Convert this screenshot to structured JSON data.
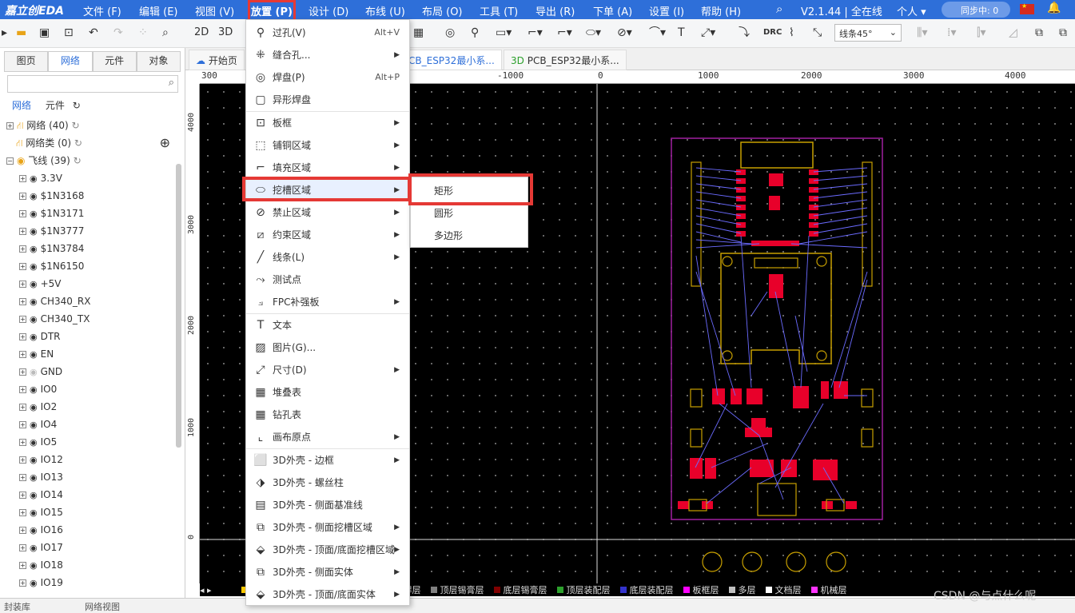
{
  "menubar": {
    "logo": "嘉立创EDA",
    "items": [
      "文件 (F)",
      "编辑 (E)",
      "视图 (V)",
      "放置 (P)",
      "设计 (D)",
      "布线 (U)",
      "布局 (O)",
      "工具 (T)",
      "导出 (R)",
      "下单 (A)",
      "设置 (I)",
      "帮助 (H)"
    ],
    "version": "V2.1.44 | 全在线",
    "user": "个人",
    "sync": "同步中: 0"
  },
  "toolbar": {
    "btn2d": "2D",
    "btn3d": "3D",
    "line_angle": "线条45°",
    "drc": "DRC"
  },
  "left_panel": {
    "tabs": [
      "图页",
      "网络",
      "元件",
      "对象"
    ],
    "active_tab": "网络",
    "search_placeholder": "",
    "subtabs": [
      "网络",
      "元件"
    ],
    "groups": [
      {
        "label": "网络 (40)"
      },
      {
        "label": "网络类 (0)"
      },
      {
        "label": "飞线 (39)"
      }
    ],
    "nets": [
      "3.3V",
      "$1N3168",
      "$1N3171",
      "$1N3777",
      "$1N3784",
      "$1N6150",
      "+5V",
      "CH340_RX",
      "CH340_TX",
      "DTR",
      "EN",
      "GND",
      "IO0",
      "IO2",
      "IO4",
      "IO5",
      "IO12",
      "IO13",
      "IO14",
      "IO15",
      "IO16",
      "IO17",
      "IO18",
      "IO19"
    ]
  },
  "doc_tabs": [
    "开始页",
    "CB_ESP32最小系...",
    "PCB_ESP32最小系..."
  ],
  "ruler": {
    "top": [
      "300",
      "-1000",
      "0",
      "1000",
      "2000",
      "3000",
      "4000"
    ],
    "left": [
      "4000",
      "3000",
      "2000",
      "1000",
      "0"
    ]
  },
  "layers": [
    "底层丝印层",
    "顶层阻焊层",
    "底层阻焊层",
    "顶层锡膏层",
    "底层锡膏层",
    "顶层装配层",
    "底层装配层",
    "板框层",
    "多层",
    "文档层",
    "机械层"
  ],
  "layer_colors": [
    "#ffcc00",
    "#8000ff",
    "#aa00aa",
    "#808080",
    "#800000",
    "#2ca02c",
    "#3333cc",
    "#ff00ff",
    "#c0c0c0",
    "#ffffff",
    "#ff33ff"
  ],
  "status": [
    "封装库",
    "网络视图"
  ],
  "watermark": "CSDN @与点什么呢",
  "place_menu": {
    "items": [
      {
        "icon": "via-icon",
        "label": "过孔(V)",
        "shortcut": "Alt+V",
        "sub": false
      },
      {
        "icon": "stitch-icon",
        "label": "缝合孔...",
        "shortcut": "",
        "sub": true
      },
      {
        "icon": "pad-icon",
        "label": "焊盘(P)",
        "shortcut": "Alt+P",
        "sub": false
      },
      {
        "icon": "shaped-pad-icon",
        "label": "异形焊盘",
        "shortcut": "",
        "sub": false
      },
      {
        "icon": "board-outline-icon",
        "label": "板框",
        "shortcut": "",
        "sub": true
      },
      {
        "icon": "copper-area-icon",
        "label": "铺铜区域",
        "shortcut": "",
        "sub": true
      },
      {
        "icon": "fill-area-icon",
        "label": "填充区域",
        "shortcut": "",
        "sub": true
      },
      {
        "icon": "slot-area-icon",
        "label": "挖槽区域",
        "shortcut": "",
        "sub": true
      },
      {
        "icon": "keepout-icon",
        "label": "禁止区域",
        "shortcut": "",
        "sub": true
      },
      {
        "icon": "constraint-icon",
        "label": "约束区域",
        "shortcut": "",
        "sub": true
      },
      {
        "icon": "line-icon",
        "label": "线条(L)",
        "shortcut": "",
        "sub": true
      },
      {
        "icon": "test-point-icon",
        "label": "测试点",
        "shortcut": "",
        "sub": false
      },
      {
        "icon": "fpc-stiffener-icon",
        "label": "FPC补强板",
        "shortcut": "",
        "sub": true
      },
      {
        "icon": "text-icon",
        "label": "文本",
        "shortcut": "",
        "sub": false
      },
      {
        "icon": "image-icon",
        "label": "图片(G)...",
        "shortcut": "",
        "sub": false
      },
      {
        "icon": "dimension-icon",
        "label": "尺寸(D)",
        "shortcut": "",
        "sub": true
      },
      {
        "icon": "stackup-table-icon",
        "label": "堆叠表",
        "shortcut": "",
        "sub": false
      },
      {
        "icon": "drill-table-icon",
        "label": "钻孔表",
        "shortcut": "",
        "sub": false
      },
      {
        "icon": "origin-icon",
        "label": "画布原点",
        "shortcut": "",
        "sub": true
      },
      {
        "icon": "shell-frame-icon",
        "label": "3D外壳 - 边框",
        "shortcut": "",
        "sub": true
      },
      {
        "icon": "shell-screw-icon",
        "label": "3D外壳 - 螺丝柱",
        "shortcut": "",
        "sub": false
      },
      {
        "icon": "shell-side-ref-icon",
        "label": "3D外壳 - 侧面基准线",
        "shortcut": "",
        "sub": false
      },
      {
        "icon": "shell-side-slot-icon",
        "label": "3D外壳 - 侧面挖槽区域",
        "shortcut": "",
        "sub": true
      },
      {
        "icon": "shell-topbot-slot-icon",
        "label": "3D外壳 - 顶面/底面挖槽区域",
        "shortcut": "",
        "sub": true
      },
      {
        "icon": "shell-side-solid-icon",
        "label": "3D外壳 - 侧面实体",
        "shortcut": "",
        "sub": true
      },
      {
        "icon": "shell-topbot-solid-icon",
        "label": "3D外壳 - 顶面/底面实体",
        "shortcut": "",
        "sub": true
      }
    ],
    "highlighted": "挖槽区域",
    "submenu": [
      "矩形",
      "圆形",
      "多边形"
    ]
  }
}
